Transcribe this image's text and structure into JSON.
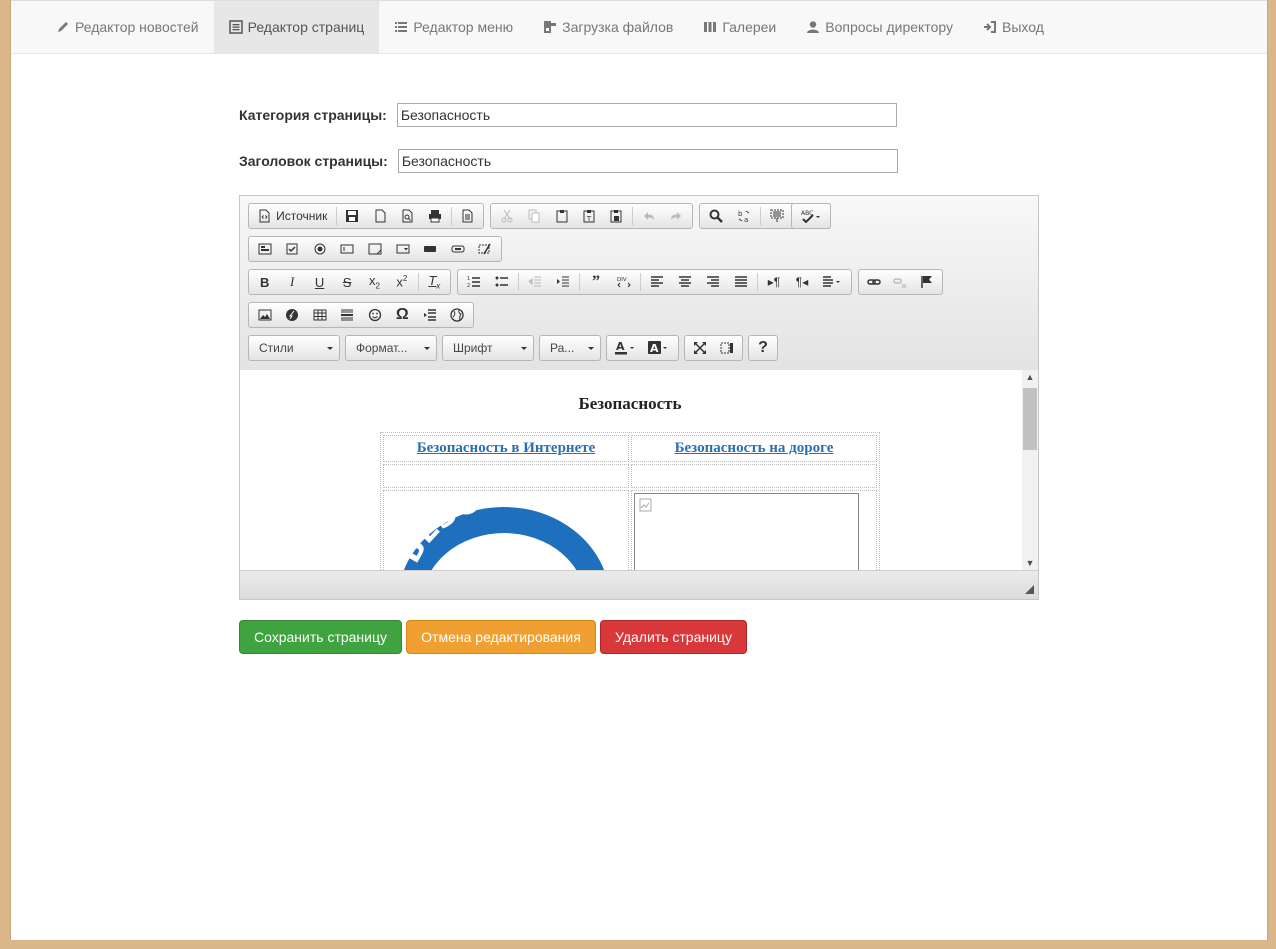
{
  "nav": {
    "items": [
      {
        "label": "Редактор новостей",
        "icon": "pencil-icon"
      },
      {
        "label": "Редактор страниц",
        "icon": "list-alt-icon",
        "active": true
      },
      {
        "label": "Редактор меню",
        "icon": "list-icon"
      },
      {
        "label": "Загрузка файлов",
        "icon": "upload-icon"
      },
      {
        "label": "Галереи",
        "icon": "grid-icon"
      },
      {
        "label": "Вопросы директору",
        "icon": "user-icon"
      },
      {
        "label": "Выход",
        "icon": "logout-icon"
      }
    ]
  },
  "form": {
    "category_label": "Категория страницы:",
    "category_value": "Безопасность",
    "title_label": "Заголовок страницы:",
    "title_value": "Безопасность"
  },
  "editor": {
    "source_label": "Источник",
    "combos": {
      "styles": "Стили",
      "format": "Формат...",
      "font": "Шрифт",
      "size": "Ра..."
    },
    "content": {
      "title": "Безопасность",
      "link1": "Безопасность в Интернете",
      "link2": "Безопасность на дороге",
      "image_text": "БЕЗОПАСНЫ"
    }
  },
  "buttons": {
    "save": "Сохранить страницу",
    "cancel": "Отмена редактирования",
    "delete": "Удалить страницу"
  },
  "colors": {
    "save": "#3fa33f",
    "cancel": "#f0a030",
    "delete": "#d9383a",
    "link": "#2a6fb3"
  }
}
